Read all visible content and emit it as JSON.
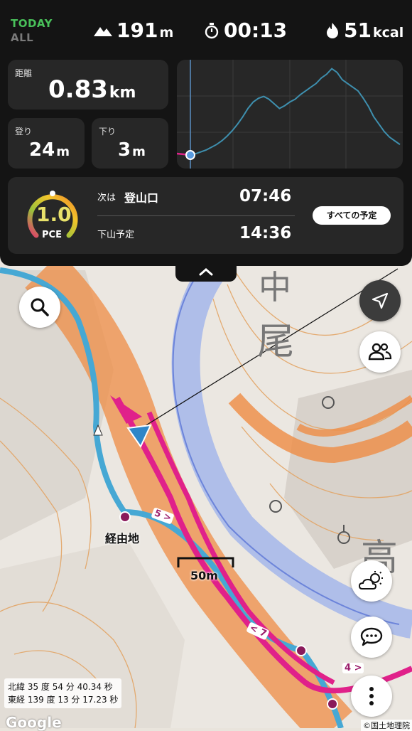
{
  "top_stats": {
    "period_today": "TODAY",
    "period_all": "ALL",
    "elevation": {
      "icon": "mountain-icon",
      "value": "191",
      "unit": "m"
    },
    "time": {
      "icon": "stopwatch-icon",
      "value": "00:13"
    },
    "calories": {
      "icon": "flame-icon",
      "value": "51",
      "unit": "kcal"
    }
  },
  "distance": {
    "label": "距離",
    "value": "0.83",
    "unit": "km"
  },
  "ascent": {
    "label": "登り",
    "value": "24",
    "unit": "m"
  },
  "descent": {
    "label": "下り",
    "value": "3",
    "unit": "m"
  },
  "elevation_profile": {
    "line_color": "#3e8fae",
    "walked_color": "#e0218a",
    "profile": [
      0.05,
      0.06,
      0.08,
      0.1,
      0.13,
      0.16,
      0.2,
      0.25,
      0.31,
      0.38,
      0.46,
      0.55,
      0.62,
      0.66,
      0.68,
      0.65,
      0.6,
      0.55,
      0.58,
      0.62,
      0.65,
      0.7,
      0.74,
      0.78,
      0.82,
      0.88,
      0.92,
      0.98,
      0.94,
      0.86,
      0.82,
      0.78,
      0.74,
      0.66,
      0.57,
      0.46,
      0.38,
      0.3,
      0.24,
      0.2,
      0.16
    ]
  },
  "plan": {
    "pace_value": "1.0",
    "pace_label": "PCE",
    "next_label": "次は",
    "next_point": "登山口",
    "next_time": "07:46",
    "descent_label": "下山予定",
    "descent_time": "14:36",
    "all_plans_button": "すべての予定"
  },
  "map": {
    "waypoint_label": "経由地",
    "scale_label": "50m",
    "marker_5": "5 >",
    "marker_4": "4 >",
    "marker_7": "< 7",
    "kanji_1": "中",
    "kanji_2": "尾",
    "kanji_3": "高"
  },
  "coordinates": {
    "lat": "北緯 35 度 54 分 40.34 秒",
    "lng": "東経 139 度 13 分 17.23 秒"
  },
  "attribution": {
    "google": "Google",
    "gsi": "©国土地理院"
  },
  "buttons": {
    "search": "search-icon",
    "locate": "location-arrow-icon",
    "people": "people-icon",
    "weather": "weather-icon",
    "chat": "chat-icon",
    "more": "more-icon"
  }
}
